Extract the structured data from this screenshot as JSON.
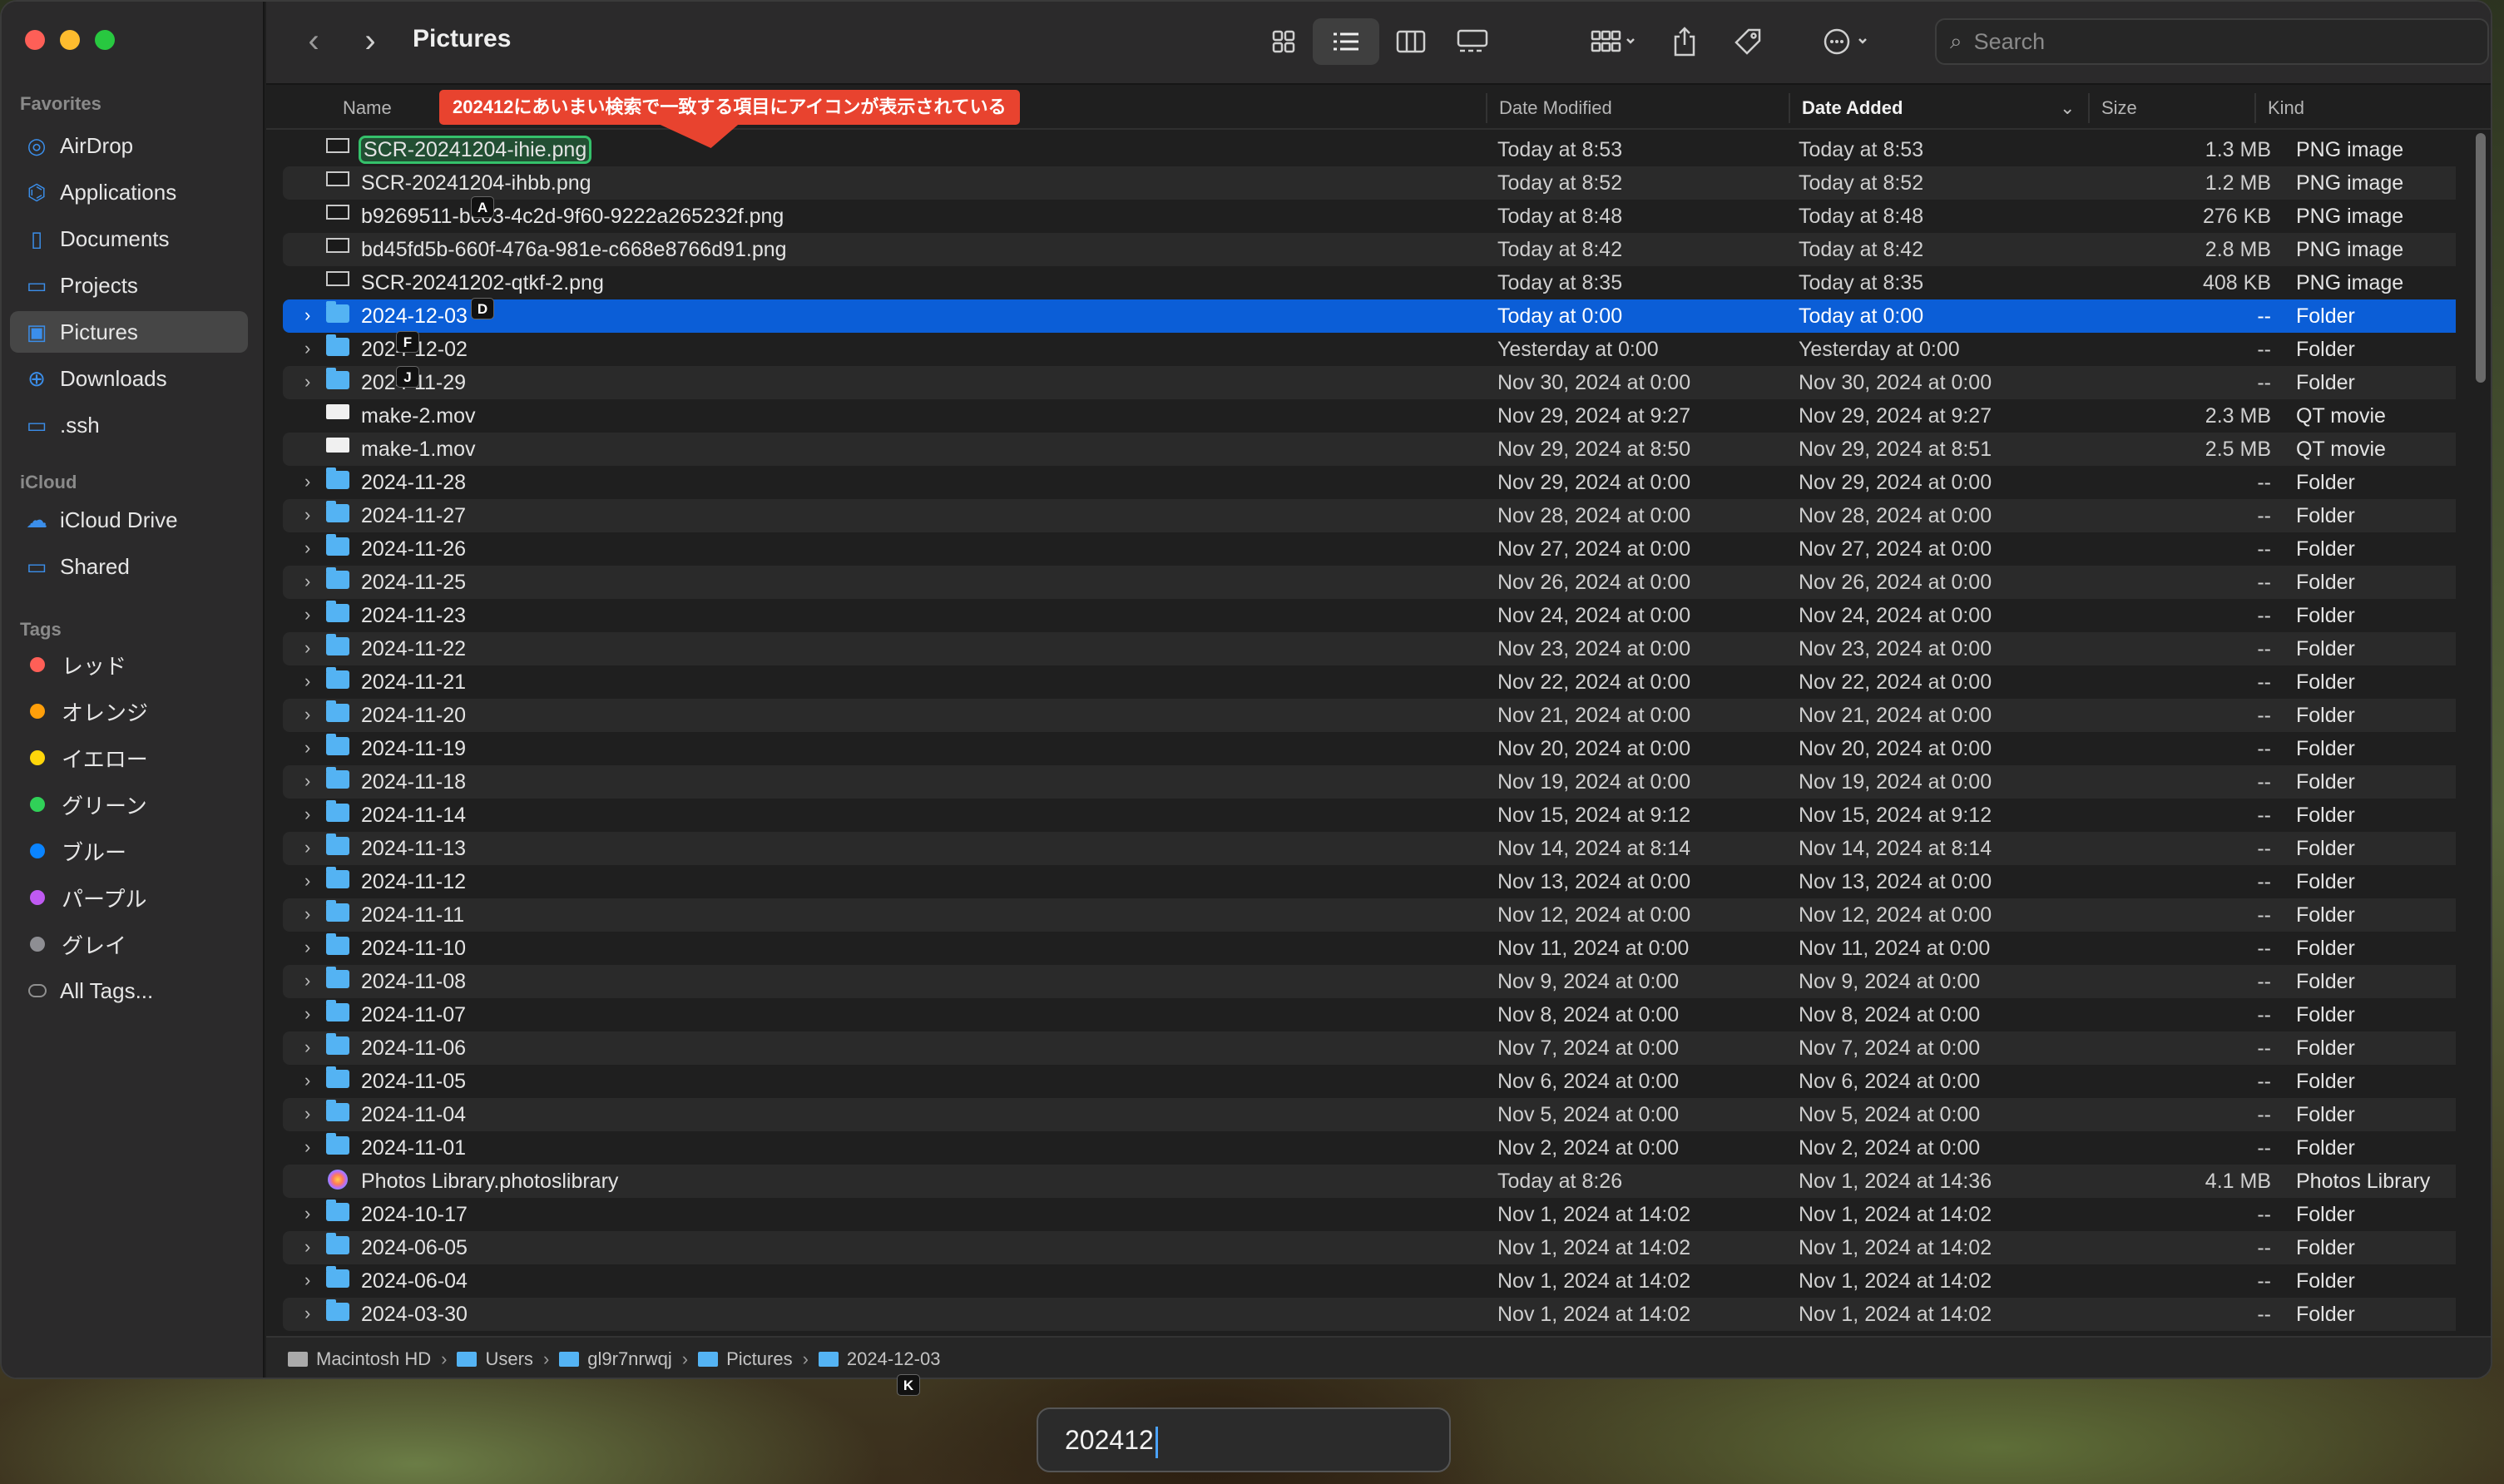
{
  "window": {
    "title": "Pictures"
  },
  "sidebar": {
    "favorites_label": "Favorites",
    "favorites": [
      {
        "label": "AirDrop",
        "icon": "airdrop-icon"
      },
      {
        "label": "Applications",
        "icon": "applications-icon"
      },
      {
        "label": "Documents",
        "icon": "document-icon"
      },
      {
        "label": "Projects",
        "icon": "folder-icon"
      },
      {
        "label": "Pictures",
        "icon": "pictures-icon",
        "active": true
      },
      {
        "label": "Downloads",
        "icon": "download-icon"
      },
      {
        "label": ".ssh",
        "icon": "folder-icon"
      }
    ],
    "icloud_label": "iCloud",
    "icloud": [
      {
        "label": "iCloud Drive",
        "icon": "cloud-icon"
      },
      {
        "label": "Shared",
        "icon": "shared-folder-icon"
      }
    ],
    "tags_label": "Tags",
    "tags": [
      {
        "label": "レッド",
        "color": "#ff5f57"
      },
      {
        "label": "オレンジ",
        "color": "#ff9f0a"
      },
      {
        "label": "イエロー",
        "color": "#ffd60a"
      },
      {
        "label": "グリーン",
        "color": "#30d158"
      },
      {
        "label": "ブルー",
        "color": "#0a84ff"
      },
      {
        "label": "パープル",
        "color": "#bf5af2"
      },
      {
        "label": "グレイ",
        "color": "#8e8e93"
      }
    ],
    "all_tags": "All Tags..."
  },
  "toolbar": {
    "search_placeholder": "Search"
  },
  "columns": {
    "name": "Name",
    "date_modified": "Date Modified",
    "date_added": "Date Added",
    "size": "Size",
    "kind": "Kind"
  },
  "annotation": "202412にあいまい検索で一致する項目にアイコンが表示されている",
  "rows": [
    {
      "type": "image",
      "name": "SCR-20241204-ihie.png",
      "modified": "Today at 8:53",
      "added": "Today at 8:53",
      "size": "1.3 MB",
      "kind": "PNG image",
      "highlight": true
    },
    {
      "type": "image",
      "name": "SCR-20241204-ihbb.png",
      "modified": "Today at 8:52",
      "added": "Today at 8:52",
      "size": "1.2 MB",
      "kind": "PNG image"
    },
    {
      "type": "image",
      "name": "b9269511-bc03-4c2d-9f60-9222a265232f.png",
      "modified": "Today at 8:48",
      "added": "Today at 8:48",
      "size": "276 KB",
      "kind": "PNG image"
    },
    {
      "type": "image",
      "name": "bd45fd5b-660f-476a-981e-c668e8766d91.png",
      "modified": "Today at 8:42",
      "added": "Today at 8:42",
      "size": "2.8 MB",
      "kind": "PNG image"
    },
    {
      "type": "image",
      "name": "SCR-20241202-qtkf-2.png",
      "modified": "Today at 8:35",
      "added": "Today at 8:35",
      "size": "408 KB",
      "kind": "PNG image"
    },
    {
      "type": "folder",
      "name": "2024-12-03",
      "modified": "Today at 0:00",
      "added": "Today at 0:00",
      "size": "--",
      "kind": "Folder",
      "selected": true
    },
    {
      "type": "folder",
      "name": "2024-12-02",
      "modified": "Yesterday at 0:00",
      "added": "Yesterday at 0:00",
      "size": "--",
      "kind": "Folder"
    },
    {
      "type": "folder",
      "name": "2024-11-29",
      "modified": "Nov 30, 2024 at 0:00",
      "added": "Nov 30, 2024 at 0:00",
      "size": "--",
      "kind": "Folder"
    },
    {
      "type": "movie",
      "name": "make-2.mov",
      "modified": "Nov 29, 2024 at 9:27",
      "added": "Nov 29, 2024 at 9:27",
      "size": "2.3 MB",
      "kind": "QT movie"
    },
    {
      "type": "movie",
      "name": "make-1.mov",
      "modified": "Nov 29, 2024 at 8:50",
      "added": "Nov 29, 2024 at 8:51",
      "size": "2.5 MB",
      "kind": "QT movie"
    },
    {
      "type": "folder",
      "name": "2024-11-28",
      "modified": "Nov 29, 2024 at 0:00",
      "added": "Nov 29, 2024 at 0:00",
      "size": "--",
      "kind": "Folder"
    },
    {
      "type": "folder",
      "name": "2024-11-27",
      "modified": "Nov 28, 2024 at 0:00",
      "added": "Nov 28, 2024 at 0:00",
      "size": "--",
      "kind": "Folder"
    },
    {
      "type": "folder",
      "name": "2024-11-26",
      "modified": "Nov 27, 2024 at 0:00",
      "added": "Nov 27, 2024 at 0:00",
      "size": "--",
      "kind": "Folder"
    },
    {
      "type": "folder",
      "name": "2024-11-25",
      "modified": "Nov 26, 2024 at 0:00",
      "added": "Nov 26, 2024 at 0:00",
      "size": "--",
      "kind": "Folder"
    },
    {
      "type": "folder",
      "name": "2024-11-23",
      "modified": "Nov 24, 2024 at 0:00",
      "added": "Nov 24, 2024 at 0:00",
      "size": "--",
      "kind": "Folder"
    },
    {
      "type": "folder",
      "name": "2024-11-22",
      "modified": "Nov 23, 2024 at 0:00",
      "added": "Nov 23, 2024 at 0:00",
      "size": "--",
      "kind": "Folder"
    },
    {
      "type": "folder",
      "name": "2024-11-21",
      "modified": "Nov 22, 2024 at 0:00",
      "added": "Nov 22, 2024 at 0:00",
      "size": "--",
      "kind": "Folder"
    },
    {
      "type": "folder",
      "name": "2024-11-20",
      "modified": "Nov 21, 2024 at 0:00",
      "added": "Nov 21, 2024 at 0:00",
      "size": "--",
      "kind": "Folder"
    },
    {
      "type": "folder",
      "name": "2024-11-19",
      "modified": "Nov 20, 2024 at 0:00",
      "added": "Nov 20, 2024 at 0:00",
      "size": "--",
      "kind": "Folder"
    },
    {
      "type": "folder",
      "name": "2024-11-18",
      "modified": "Nov 19, 2024 at 0:00",
      "added": "Nov 19, 2024 at 0:00",
      "size": "--",
      "kind": "Folder"
    },
    {
      "type": "folder",
      "name": "2024-11-14",
      "modified": "Nov 15, 2024 at 9:12",
      "added": "Nov 15, 2024 at 9:12",
      "size": "--",
      "kind": "Folder"
    },
    {
      "type": "folder",
      "name": "2024-11-13",
      "modified": "Nov 14, 2024 at 8:14",
      "added": "Nov 14, 2024 at 8:14",
      "size": "--",
      "kind": "Folder"
    },
    {
      "type": "folder",
      "name": "2024-11-12",
      "modified": "Nov 13, 2024 at 0:00",
      "added": "Nov 13, 2024 at 0:00",
      "size": "--",
      "kind": "Folder"
    },
    {
      "type": "folder",
      "name": "2024-11-11",
      "modified": "Nov 12, 2024 at 0:00",
      "added": "Nov 12, 2024 at 0:00",
      "size": "--",
      "kind": "Folder"
    },
    {
      "type": "folder",
      "name": "2024-11-10",
      "modified": "Nov 11, 2024 at 0:00",
      "added": "Nov 11, 2024 at 0:00",
      "size": "--",
      "kind": "Folder"
    },
    {
      "type": "folder",
      "name": "2024-11-08",
      "modified": "Nov 9, 2024 at 0:00",
      "added": "Nov 9, 2024 at 0:00",
      "size": "--",
      "kind": "Folder"
    },
    {
      "type": "folder",
      "name": "2024-11-07",
      "modified": "Nov 8, 2024 at 0:00",
      "added": "Nov 8, 2024 at 0:00",
      "size": "--",
      "kind": "Folder"
    },
    {
      "type": "folder",
      "name": "2024-11-06",
      "modified": "Nov 7, 2024 at 0:00",
      "added": "Nov 7, 2024 at 0:00",
      "size": "--",
      "kind": "Folder"
    },
    {
      "type": "folder",
      "name": "2024-11-05",
      "modified": "Nov 6, 2024 at 0:00",
      "added": "Nov 6, 2024 at 0:00",
      "size": "--",
      "kind": "Folder"
    },
    {
      "type": "folder",
      "name": "2024-11-04",
      "modified": "Nov 5, 2024 at 0:00",
      "added": "Nov 5, 2024 at 0:00",
      "size": "--",
      "kind": "Folder"
    },
    {
      "type": "folder",
      "name": "2024-11-01",
      "modified": "Nov 2, 2024 at 0:00",
      "added": "Nov 2, 2024 at 0:00",
      "size": "--",
      "kind": "Folder"
    },
    {
      "type": "photos",
      "name": "Photos Library.photoslibrary",
      "modified": "Today at 8:26",
      "added": "Nov 1, 2024 at 14:36",
      "size": "4.1 MB",
      "kind": "Photos Library"
    },
    {
      "type": "folder",
      "name": "2024-10-17",
      "modified": "Nov 1, 2024 at 14:02",
      "added": "Nov 1, 2024 at 14:02",
      "size": "--",
      "kind": "Folder"
    },
    {
      "type": "folder",
      "name": "2024-06-05",
      "modified": "Nov 1, 2024 at 14:02",
      "added": "Nov 1, 2024 at 14:02",
      "size": "--",
      "kind": "Folder"
    },
    {
      "type": "folder",
      "name": "2024-06-04",
      "modified": "Nov 1, 2024 at 14:02",
      "added": "Nov 1, 2024 at 14:02",
      "size": "--",
      "kind": "Folder"
    },
    {
      "type": "folder",
      "name": "2024-03-30",
      "modified": "Nov 1, 2024 at 14:02",
      "added": "Nov 1, 2024 at 14:02",
      "size": "--",
      "kind": "Folder"
    }
  ],
  "hints": [
    {
      "label": "A",
      "row": 1
    },
    {
      "label": "D",
      "row": 4
    },
    {
      "label": "F",
      "row": 5
    },
    {
      "label": "J",
      "row": 6
    },
    {
      "label": "K",
      "row": -1
    }
  ],
  "pathbar": [
    "Macintosh HD",
    "Users",
    "gl9r7nrwqj",
    "Pictures",
    "2024-12-03"
  ],
  "typebox": {
    "value": "202412"
  }
}
